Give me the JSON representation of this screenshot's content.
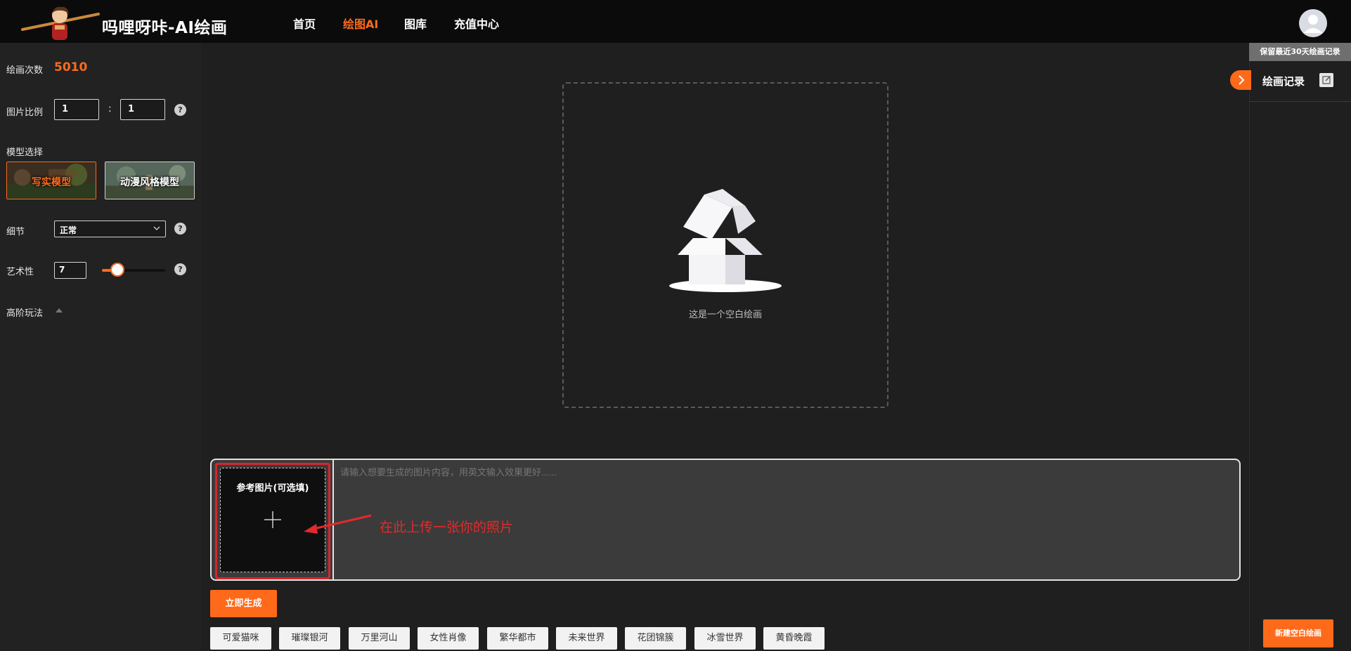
{
  "brand": {
    "name": "吗哩呀咔-AI绘画"
  },
  "nav": {
    "items": [
      {
        "label": "首页"
      },
      {
        "label": "绘图AI"
      },
      {
        "label": "图库"
      },
      {
        "label": "充值中心"
      }
    ],
    "active": "绘图AI"
  },
  "sidebar": {
    "draw_count_label": "绘画次数",
    "draw_count_value": "5010",
    "ratio_label": "图片比例",
    "ratio_w": "1",
    "ratio_h": "1",
    "ratio_colon": ":",
    "model_label": "模型选择",
    "models": [
      {
        "name": "写实模型"
      },
      {
        "name": "动漫风格模型"
      }
    ],
    "detail_label": "细节",
    "detail_value": "正常",
    "art_label": "艺术性",
    "art_value": "7",
    "art_level": 0.15,
    "advanced_label": "高阶玩法",
    "help_glyph": "?"
  },
  "canvas": {
    "empty_text": "这是一个空白绘画"
  },
  "prompt": {
    "upload_title": "参考图片(可选填)",
    "placeholder": "请输入想要生成的图片内容，用英文输入效果更好......",
    "annotation": "在此上传一张你的照片"
  },
  "generate_label": "立即生成",
  "tags": [
    "可爱猫咪",
    "璀璨银河",
    "万里河山",
    "女性肖像",
    "繁华都市",
    "未来世界",
    "花团锦簇",
    "冰雪世界",
    "黄昏晚霞"
  ],
  "right_panel": {
    "note": "保留最近30天绘画记录",
    "title": "绘画记录",
    "new_button": "新建空白绘画"
  },
  "colors": {
    "accent": "#ff6a1a",
    "annotation": "#e22a2a"
  }
}
